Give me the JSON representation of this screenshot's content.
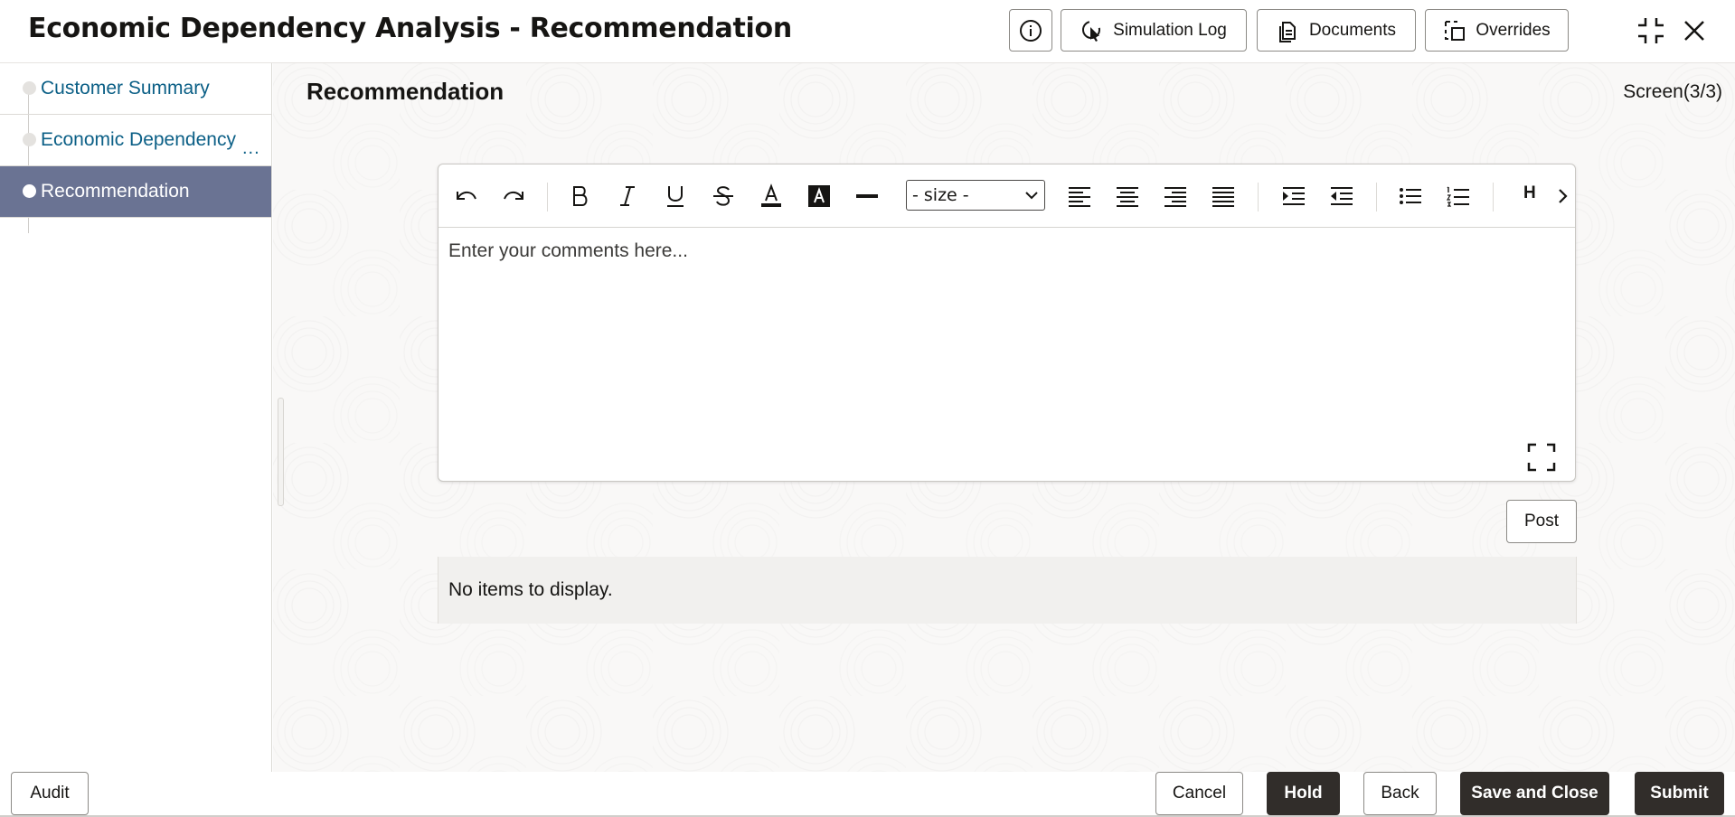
{
  "header": {
    "title": "Economic Dependency Analysis - Recommendation",
    "simulation_log_label": "Simulation Log",
    "documents_label": "Documents",
    "overrides_label": "Overrides"
  },
  "sidebar": {
    "items": [
      {
        "label": "Customer Summary",
        "active": false
      },
      {
        "label": "Economic Dependency",
        "active": false,
        "overflow": "..."
      },
      {
        "label": "Recommendation",
        "active": true
      }
    ]
  },
  "main": {
    "title": "Recommendation",
    "screen_counter": "Screen(3/3)",
    "editor": {
      "size_select_value": "- size -",
      "heading_label": "H",
      "placeholder": "Enter your comments here..."
    },
    "post_label": "Post",
    "empty_message": "No items to display."
  },
  "footer": {
    "audit_label": "Audit",
    "cancel_label": "Cancel",
    "hold_label": "Hold",
    "back_label": "Back",
    "save_close_label": "Save and Close",
    "submit_label": "Submit"
  },
  "colors": {
    "active_nav_bg": "#6a7393",
    "link_color": "#0b5f86",
    "primary_button_bg": "#312d2a"
  }
}
